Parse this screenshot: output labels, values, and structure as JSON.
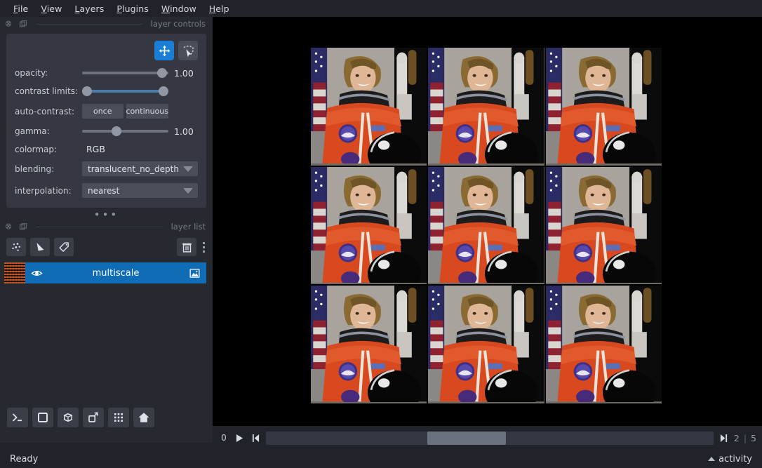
{
  "menu": {
    "items": [
      {
        "label": "File",
        "accel": "F"
      },
      {
        "label": "View",
        "accel": "V"
      },
      {
        "label": "Layers",
        "accel": "L"
      },
      {
        "label": "Plugins",
        "accel": "P"
      },
      {
        "label": "Window",
        "accel": "W"
      },
      {
        "label": "Help",
        "accel": "H"
      }
    ]
  },
  "layer_controls": {
    "dock_title": "layer controls",
    "tools": [
      {
        "name": "pan-zoom-tool",
        "icon": "move-icon",
        "active": true
      },
      {
        "name": "transform-tool",
        "icon": "transform-icon",
        "active": false
      }
    ],
    "rows": {
      "opacity_label": "opacity:",
      "opacity_value": "1.00",
      "contrast_label": "contrast limits:",
      "autocontrast_label": "auto-contrast:",
      "autocontrast_once": "once",
      "autocontrast_continuous": "continuous",
      "gamma_label": "gamma:",
      "gamma_value": "1.00",
      "colormap_label": "colormap:",
      "colormap_value": "RGB",
      "blending_label": "blending:",
      "blending_value": "translucent_no_depth",
      "interpolation_label": "interpolation:",
      "interpolation_value": "nearest"
    }
  },
  "layer_list": {
    "dock_title": "layer list",
    "buttons": [
      {
        "name": "new-points-layer",
        "icon": "points-icon"
      },
      {
        "name": "new-shapes-layer",
        "icon": "shapes-icon"
      },
      {
        "name": "new-labels-layer",
        "icon": "labels-icon"
      },
      {
        "name": "delete-layer",
        "icon": "trash-icon"
      },
      {
        "name": "layer-list-menu",
        "icon": "kebab-icon"
      }
    ],
    "layers": [
      {
        "name": "multiscale",
        "visible": true,
        "selected": true,
        "type_icon": "image-icon"
      }
    ]
  },
  "viewer_buttons": [
    {
      "name": "console-button",
      "icon": "console-icon"
    },
    {
      "name": "ndisplay-toggle-2d",
      "icon": "square-icon"
    },
    {
      "name": "ndisplay-toggle-3d",
      "icon": "cube-icon"
    },
    {
      "name": "roll-dims-button",
      "icon": "roll-icon"
    },
    {
      "name": "grid-view-button",
      "icon": "grid-icon"
    },
    {
      "name": "home-button",
      "icon": "home-icon"
    }
  ],
  "canvas": {
    "grid_rows": 3,
    "grid_cols": 3,
    "tile_label": "astronaut-image"
  },
  "dim_slider": {
    "axis_label": "0",
    "play_icon": "play-icon",
    "step_start_icon": "step-start-icon",
    "step_end_icon": "step-end-icon",
    "current_value": "2",
    "separator": "|",
    "max_value": "5"
  },
  "status": {
    "message": "Ready",
    "activity_label": "activity"
  },
  "colors": {
    "accent": "#0f6cb5",
    "tool_active": "#1a7fd4",
    "panel": "#353841",
    "background": "#262930",
    "canvas": "#000000"
  }
}
